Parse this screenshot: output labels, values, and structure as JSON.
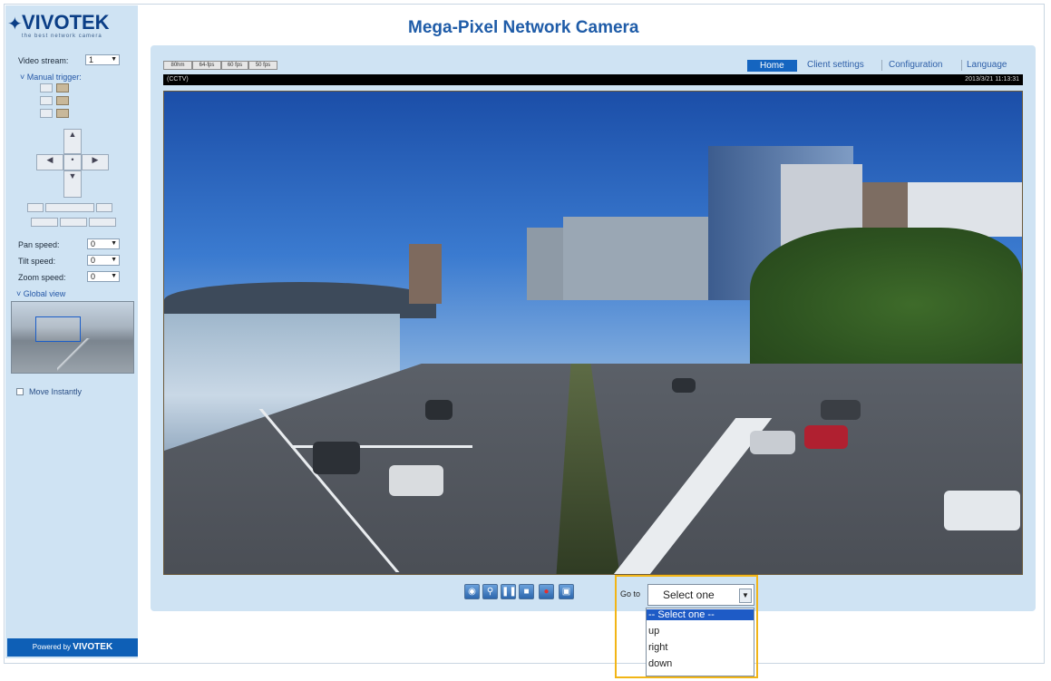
{
  "brand": {
    "logo_text": "VIVOTEK",
    "logo_tagline": "the best network camera",
    "powered_prefix": "Powered by",
    "powered_brand": "VIVOTEK"
  },
  "page_title": "Mega-Pixel Network Camera",
  "nav": {
    "home": "Home",
    "client_settings": "Client settings",
    "configuration": "Configuration",
    "language": "Language"
  },
  "sidebar": {
    "video_stream_label": "Video stream:",
    "video_stream_value": "1",
    "manual_trigger": "Manual trigger:",
    "pan_speed_label": "Pan speed:",
    "pan_speed_value": "0",
    "tilt_speed_label": "Tilt speed:",
    "tilt_speed_value": "0",
    "zoom_speed_label": "Zoom speed:",
    "zoom_speed_value": "0",
    "global_view": "Global view",
    "move_instantly": "Move Instantly"
  },
  "toolbar": {
    "buttons": [
      "80hm",
      "64-fps",
      "60 fps",
      "50 fps"
    ]
  },
  "video": {
    "caption": "(CCTV)",
    "timestamp": "2013/3/21 11:13:31"
  },
  "goto": {
    "label": "Go to",
    "selected": "Select one",
    "options": [
      "-- Select one --",
      "up",
      "right",
      "down"
    ]
  },
  "colors": {
    "accent": "#1565c0",
    "highlight": "#f2b516",
    "panel": "#cfe3f3"
  }
}
